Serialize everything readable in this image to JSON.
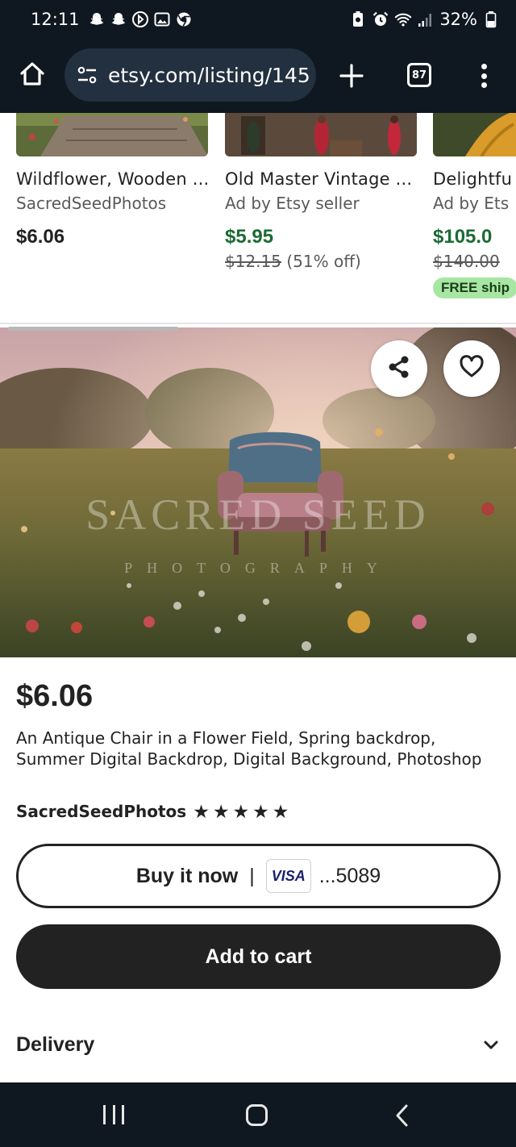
{
  "status_bar": {
    "time": "12:11",
    "battery": "32%",
    "icons": [
      "snapchat-icon",
      "snapchat-icon",
      "cast-icon",
      "gallery-icon",
      "chrome-icon",
      "battery-saver-icon",
      "alarm-icon",
      "wifi-icon",
      "signal-icon",
      "battery-icon"
    ]
  },
  "browser": {
    "url": "etsy.com/listing/145",
    "tab_count": "87"
  },
  "carousel": {
    "items": [
      {
        "title": "Wildflower, Wooden ...",
        "seller": "SacredSeedPhotos",
        "price": "$6.06"
      },
      {
        "title": "Old Master Vintage ...",
        "seller": "Ad by Etsy seller",
        "price": "$5.95",
        "original_price": "$12.15",
        "discount": "(51% off)"
      },
      {
        "title": "Delightfu",
        "seller": "Ad by Ets",
        "price": "$105.0",
        "original_price": "$140.00",
        "badge": "FREE ship"
      }
    ]
  },
  "hero": {
    "watermark_top": "SACRED SEED",
    "watermark_bottom": "PHOTOGRAPHY"
  },
  "product": {
    "price": "$6.06",
    "title": "An Antique Chair in a Flower Field, Spring backdrop, Summer Digital Backdrop, Digital Background, Photoshop",
    "shop": "SacredSeedPhotos",
    "rating": 5
  },
  "actions": {
    "buy_now": "Buy it now",
    "separator": "|",
    "card_brand": "VISA",
    "card_last": "...5089",
    "add_to_cart": "Add to cart"
  },
  "delivery": {
    "label": "Delivery"
  },
  "colors": {
    "dark_bar": "#0f1720",
    "url_pill": "#22303f",
    "sale_green": "#1b6b34",
    "free_badge": "#a8e6a3",
    "button_dark": "#222222"
  }
}
